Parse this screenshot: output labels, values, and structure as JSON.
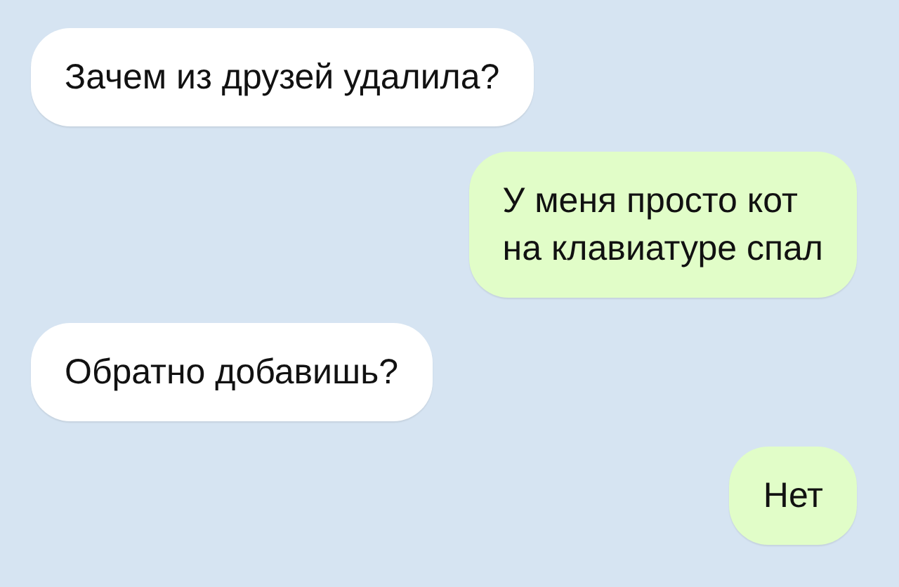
{
  "messages": [
    {
      "kind": "incoming",
      "lines": [
        "Зачем из друзей удалила?"
      ]
    },
    {
      "kind": "outgoing",
      "lines": [
        "У меня просто кот",
        "на клавиатуре спал"
      ]
    },
    {
      "kind": "incoming",
      "lines": [
        "Обратно добавишь?"
      ]
    },
    {
      "kind": "outgoing",
      "lines": [
        "Нет"
      ]
    }
  ]
}
